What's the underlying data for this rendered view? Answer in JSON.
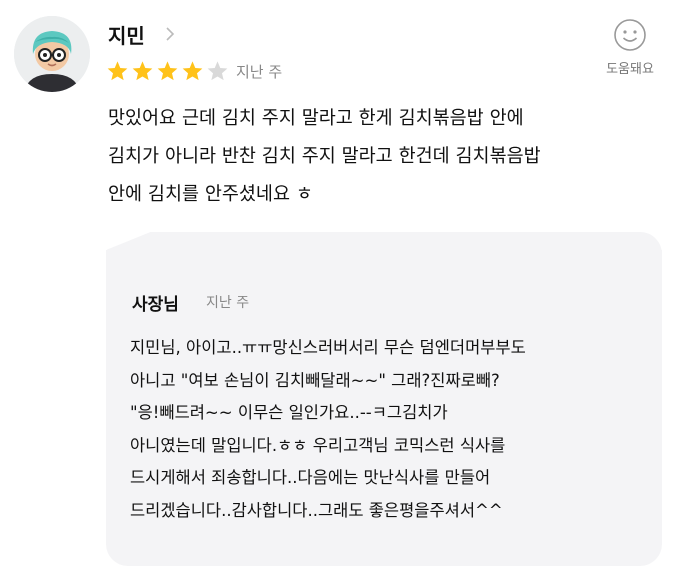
{
  "review": {
    "reviewer_name": "지민",
    "rating": 4,
    "rating_max": 5,
    "time": "지난 주",
    "helpful_label": "도움돼요",
    "text_lines": [
      "맛있어요 근데 김치 주지 말라고 한게 김치볶음밥 안에",
      "김치가 아니라 반찬 김치 주지 말라고 한건데 김치볶음밥",
      "안에 김치를 안주셨네요 ㅎ"
    ]
  },
  "owner_reply": {
    "name": "사장님",
    "time": "지난 주",
    "text_lines": [
      "지민님, 아이고..ㅠㅠ망신스러버서리 무슨 덤엔더머부부도",
      "아니고 \"여보 손님이 김치빼달래~~\" 그래?진짜로빼?",
      "\"응!빼드려~~ 이무슨 일인가요..--ㅋ그김치가",
      "아니였는데 말입니다.ㅎㅎ 우리고객님 코믹스런 식사를",
      "드시게해서 죄송합니다..다음에는 맛난식사를 만들어",
      "드리겠습니다..감사합니다..그래도 좋은평을주셔서^^"
    ]
  },
  "colors": {
    "star_filled": "#ffc21a",
    "star_empty": "#d9d9d9",
    "reply_background": "#f4f4f6",
    "meta_text": "#888888"
  },
  "icons": {
    "reviewer_link": "chevron-right-icon",
    "helpful": "smile-icon"
  }
}
